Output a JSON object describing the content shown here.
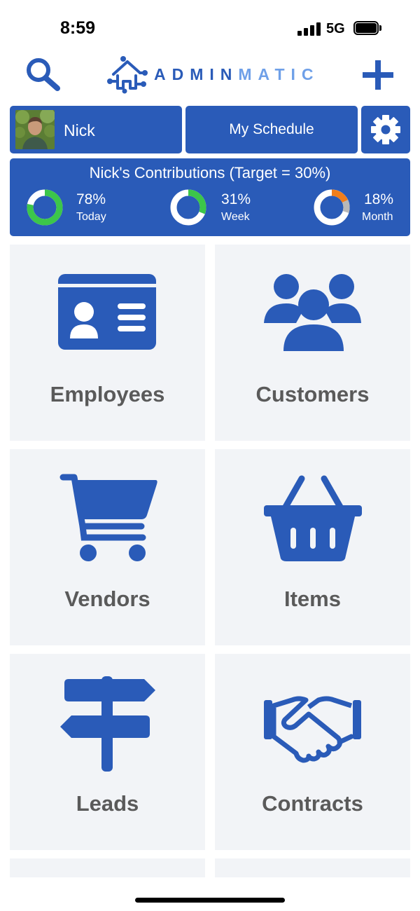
{
  "status_bar": {
    "time": "8:59",
    "network": "5G",
    "icons": [
      "signal-icon",
      "battery-icon"
    ]
  },
  "header": {
    "logo_part1": "ADMIN",
    "logo_part2": "MATIC",
    "search_icon": "search-icon",
    "add_icon": "plus-icon"
  },
  "user": {
    "name": "Nick",
    "schedule_label": "My Schedule",
    "settings_icon": "gear-icon"
  },
  "contributions": {
    "title": "Nick's Contributions (Target = 30%)",
    "metrics": [
      {
        "value": "78%",
        "label": "Today",
        "fraction": 0.78,
        "color": "#3cc64a"
      },
      {
        "value": "31%",
        "label": "Week",
        "fraction": 0.31,
        "color": "#3cc64a"
      },
      {
        "value": "18%",
        "label": "Month",
        "fraction": 0.18,
        "color": "#f07e1c"
      }
    ]
  },
  "tiles": [
    {
      "label": "Employees",
      "icon": "id-card-icon"
    },
    {
      "label": "Customers",
      "icon": "people-group-icon"
    },
    {
      "label": "Vendors",
      "icon": "shopping-cart-icon"
    },
    {
      "label": "Items",
      "icon": "basket-icon"
    },
    {
      "label": "Leads",
      "icon": "signpost-icon"
    },
    {
      "label": "Contracts",
      "icon": "handshake-icon"
    }
  ],
  "colors": {
    "brand": "#2a5bb8",
    "brand_light": "#6fa0e8",
    "tile_bg": "#f2f4f7",
    "tile_text": "#5a5a5a"
  }
}
